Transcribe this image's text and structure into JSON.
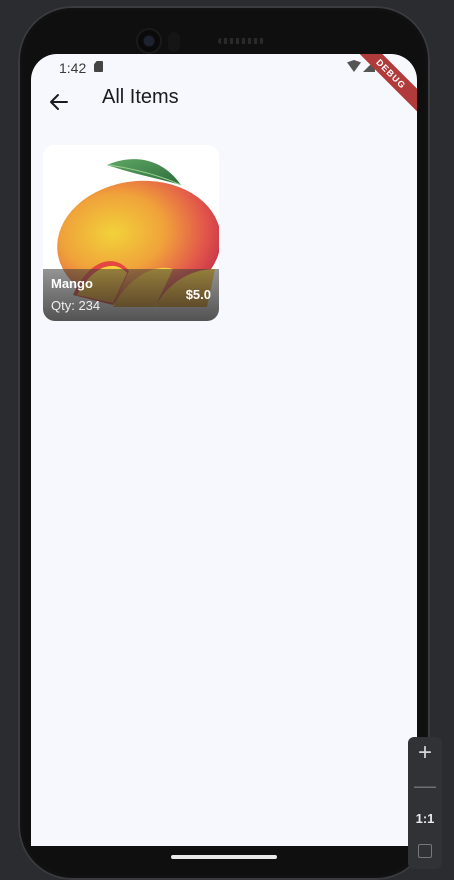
{
  "status_bar": {
    "time": "1:42"
  },
  "debug_banner": "DEBUG",
  "app_bar": {
    "title": "All Items"
  },
  "items": [
    {
      "name": "Mango",
      "qty_text": "Qty: 234",
      "price": "$5.0"
    }
  ],
  "emulator_controls": {
    "zoom_in": "+",
    "zoom_out": "—",
    "reset": "1:1"
  },
  "colors": {
    "screen_bg": "#f7f8fe",
    "debug_banner": "#b13a3a",
    "card_overlay": "#3c3c3c"
  }
}
